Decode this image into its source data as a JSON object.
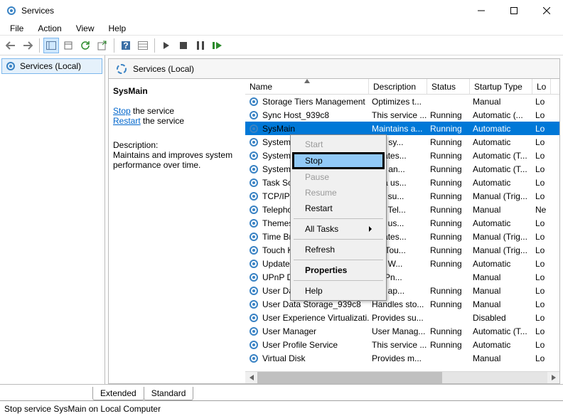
{
  "window": {
    "title": "Services"
  },
  "menu": [
    "File",
    "Action",
    "View",
    "Help"
  ],
  "tree": {
    "root": "Services (Local)"
  },
  "panel": {
    "header": "Services (Local)",
    "selected": "SysMain",
    "stop_link_prefix": "Stop",
    "stop_link_suffix": " the service",
    "restart_link_prefix": "Restart",
    "restart_link_suffix": " the service",
    "desc_title": "Description:",
    "desc_body": "Maintains and improves system performance over time."
  },
  "columns": {
    "name": "Name",
    "desc": "Description",
    "status": "Status",
    "start": "Startup Type",
    "log": "Lo"
  },
  "rows": [
    {
      "name": "Storage Tiers Management",
      "desc": "Optimizes t...",
      "status": "",
      "start": "Manual",
      "log": "Lo"
    },
    {
      "name": "Sync Host_939c8",
      "desc": "This service ...",
      "status": "Running",
      "start": "Automatic (...",
      "log": "Lo"
    },
    {
      "name": "SysMain",
      "desc": "Maintains a...",
      "status": "Running",
      "start": "Automatic",
      "log": "Lo",
      "sel": true
    },
    {
      "name": "System E",
      "desc": "tors sy...",
      "status": "Running",
      "start": "Automatic",
      "log": "Lo"
    },
    {
      "name": "System E",
      "desc": "dinates...",
      "status": "Running",
      "start": "Automatic (T...",
      "log": "Lo"
    },
    {
      "name": "System G",
      "desc": "tors an...",
      "status": "Running",
      "start": "Automatic (T...",
      "log": "Lo"
    },
    {
      "name": "Task Sch",
      "desc": "es a us...",
      "status": "Running",
      "start": "Automatic",
      "log": "Lo"
    },
    {
      "name": "TCP/IP N",
      "desc": "des su...",
      "status": "Running",
      "start": "Manual (Trig...",
      "log": "Lo"
    },
    {
      "name": "Telepho",
      "desc": "des Tel...",
      "status": "Running",
      "start": "Manual",
      "log": "Ne"
    },
    {
      "name": "Themes",
      "desc": "des us...",
      "status": "Running",
      "start": "Automatic",
      "log": "Lo"
    },
    {
      "name": "Time Bro",
      "desc": "dinates...",
      "status": "Running",
      "start": "Manual (Trig...",
      "log": "Lo"
    },
    {
      "name": "Touch K",
      "desc": "les Tou...",
      "status": "Running",
      "start": "Manual (Trig...",
      "log": "Lo"
    },
    {
      "name": "Update O",
      "desc": "ges W...",
      "status": "Running",
      "start": "Automatic",
      "log": "Lo"
    },
    {
      "name": "UPnP De",
      "desc": "s UPn...",
      "status": "",
      "start": "Manual",
      "log": "Lo"
    },
    {
      "name": "User Dat",
      "desc": "des ap...",
      "status": "Running",
      "start": "Manual",
      "log": "Lo"
    },
    {
      "name": "User Data Storage_939c8",
      "desc": "Handles sto...",
      "status": "Running",
      "start": "Manual",
      "log": "Lo"
    },
    {
      "name": "User Experience Virtualizati...",
      "desc": "Provides su...",
      "status": "",
      "start": "Disabled",
      "log": "Lo"
    },
    {
      "name": "User Manager",
      "desc": "User Manag...",
      "status": "Running",
      "start": "Automatic (T...",
      "log": "Lo"
    },
    {
      "name": "User Profile Service",
      "desc": "This service ...",
      "status": "Running",
      "start": "Automatic",
      "log": "Lo"
    },
    {
      "name": "Virtual Disk",
      "desc": "Provides m...",
      "status": "",
      "start": "Manual",
      "log": "Lo"
    }
  ],
  "context": {
    "start": "Start",
    "stop": "Stop",
    "pause": "Pause",
    "resume": "Resume",
    "restart": "Restart",
    "alltasks": "All Tasks",
    "refresh": "Refresh",
    "properties": "Properties",
    "help": "Help"
  },
  "tabs": {
    "extended": "Extended",
    "standard": "Standard"
  },
  "statusbar": "Stop service SysMain on Local Computer"
}
